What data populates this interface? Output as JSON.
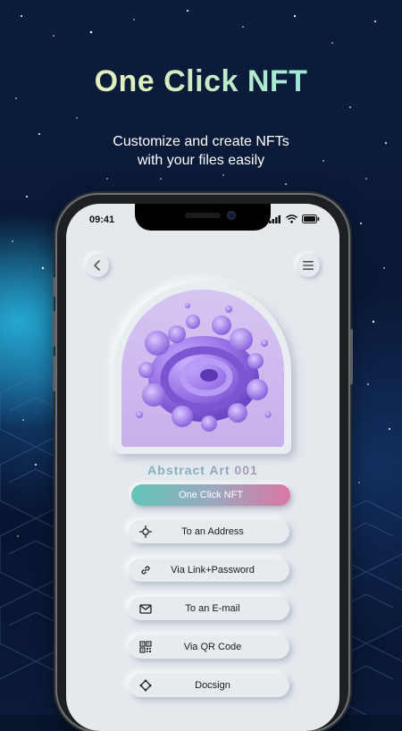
{
  "promo": {
    "headline": "One Click NFT",
    "subline_1": "Customize and create NFTs",
    "subline_2": "with your files easily"
  },
  "status_bar": {
    "time": "09:41"
  },
  "nft": {
    "title": "Abstract  Art 001"
  },
  "buttons": {
    "primary": "One Click NFT",
    "options": [
      {
        "label": "To an Address",
        "icon": "crosshair-icon"
      },
      {
        "label": "Via Link+Password",
        "icon": "link-icon"
      },
      {
        "label": "To an E-mail",
        "icon": "mail-icon"
      },
      {
        "label": "Via QR Code",
        "icon": "qr-code-icon"
      },
      {
        "label": "Docsign",
        "icon": "docsign-icon"
      }
    ]
  },
  "colors": {
    "accent_start": "#62c5b8",
    "accent_end": "#d977a2",
    "screen_bg": "#e4e9ee",
    "art_purple": "#9a74e6"
  }
}
